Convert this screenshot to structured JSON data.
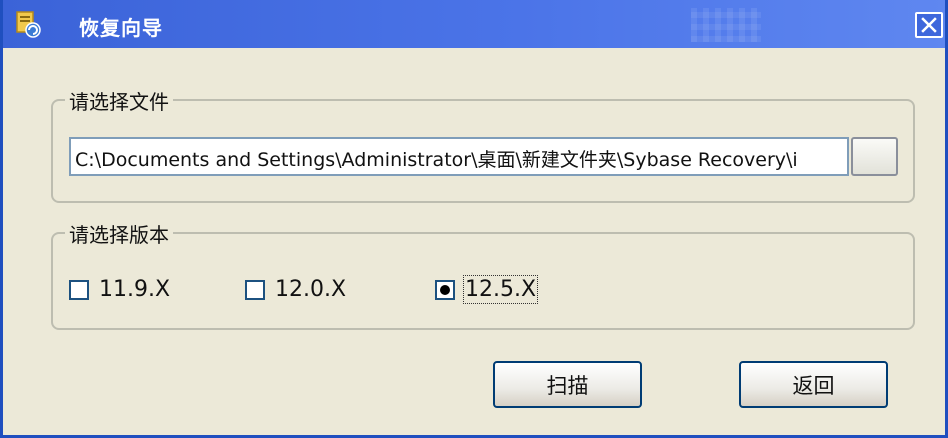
{
  "window": {
    "title": "恢复向导",
    "colors": {
      "titlebar": "#4b74e8",
      "frame": "#1f4fbf",
      "dialog_bg": "#ece9d8"
    }
  },
  "file_group": {
    "legend": "请选择文件",
    "path_value": "C:\\Documents and Settings\\Administrator\\桌面\\新建文件夹\\Sybase Recovery\\i",
    "browse_label": ""
  },
  "version_group": {
    "legend": "请选择版本",
    "options": [
      {
        "label": "11.9.X",
        "checked": false
      },
      {
        "label": "12.0.X",
        "checked": false
      },
      {
        "label": "12.5.X",
        "checked": true
      }
    ]
  },
  "buttons": {
    "scan": "扫描",
    "back": "返回"
  },
  "icons": {
    "app": "app-icon",
    "close": "close-icon"
  }
}
